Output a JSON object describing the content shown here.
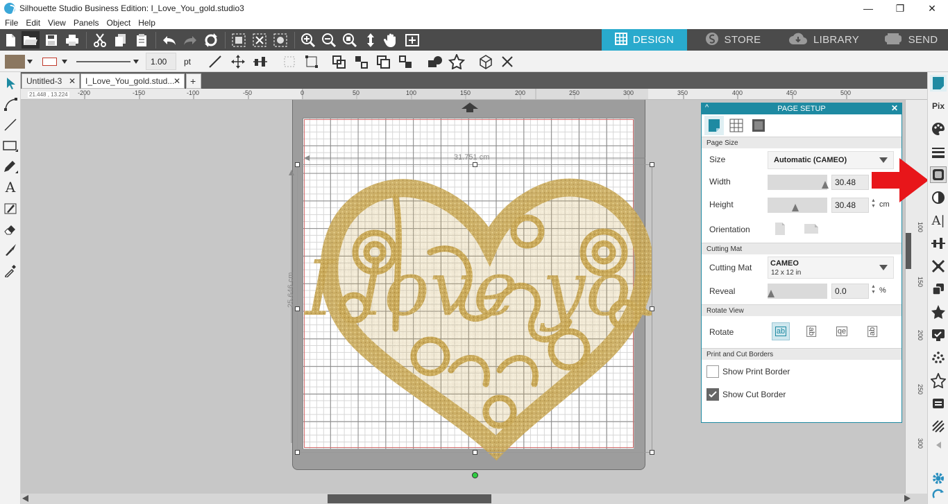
{
  "window": {
    "title": "Silhouette Studio Business Edition: I_Love_You_gold.studio3",
    "minimize": "—",
    "restore": "❐",
    "close": "✕"
  },
  "menu": [
    "File",
    "Edit",
    "View",
    "Panels",
    "Object",
    "Help"
  ],
  "mode_tabs": [
    {
      "label": "DESIGN",
      "icon": "grid-icon",
      "active": true
    },
    {
      "label": "STORE",
      "icon": "silhouette-s-icon",
      "active": false
    },
    {
      "label": "LIBRARY",
      "icon": "cloud-icon",
      "active": false
    },
    {
      "label": "SEND",
      "icon": "cutter-icon",
      "active": false
    }
  ],
  "toolbar2": {
    "line_width": "1.00",
    "line_unit": "pt",
    "fill_color": "#8b7760",
    "line_color": "#c0392b"
  },
  "doc_tabs": [
    {
      "label": "Untitled-3",
      "close": "✕"
    },
    {
      "label": "I_Love_You_gold.stud...",
      "close": "✕"
    }
  ],
  "add_tab": "+",
  "ruler": {
    "coords": "21.448 , 13.224",
    "h_labels": [
      "-200",
      "-150",
      "-100",
      "-50",
      "0",
      "50",
      "100",
      "150",
      "200",
      "250",
      "300",
      "350",
      "400",
      "450",
      "500"
    ],
    "v_labels": [
      "100",
      "150",
      "200",
      "250",
      "300"
    ]
  },
  "canvas": {
    "width_dim": "31.751 cm",
    "height_dim": "25.646 cm",
    "artwork_text": "I love you",
    "artwork_color": "#c9a95a"
  },
  "page_setup": {
    "title": "PAGE SETUP",
    "collapse": "^",
    "close": "✕",
    "sections": {
      "page_size": "Page Size",
      "cutting_mat": "Cutting Mat",
      "rotate_view": "Rotate View",
      "borders": "Print and Cut Borders"
    },
    "size_label": "Size",
    "size_value": "Automatic (CAMEO)",
    "width_label": "Width",
    "width_value": "30.48",
    "width_unit": "cm",
    "height_label": "Height",
    "height_value": "30.48",
    "height_unit": "cm",
    "orientation_label": "Orientation",
    "mat_label": "Cutting Mat",
    "mat_value": "CAMEO",
    "mat_sub": "12 x 12 in",
    "reveal_label": "Reveal",
    "reveal_value": "0.0",
    "reveal_unit": "%",
    "rotate_label": "Rotate",
    "rotate_options": [
      "ab",
      "ab",
      "qe",
      "ab"
    ],
    "print_border_label": "Show Print Border",
    "print_border_checked": false,
    "cut_border_label": "Show Cut Border",
    "cut_border_checked": true,
    "accent": "#1e8aa2"
  },
  "annotation_arrow_color": "#e8161a"
}
